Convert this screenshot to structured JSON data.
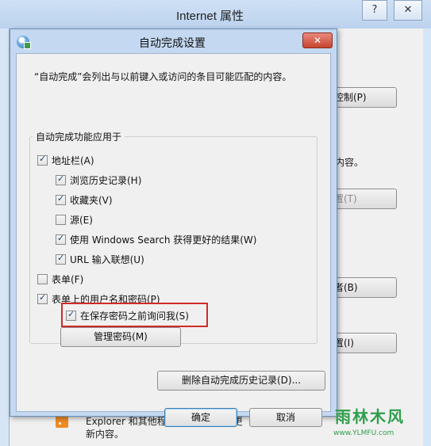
{
  "background_window": {
    "title": "Internet 属性",
    "help_label": "?",
    "close_label": "✕",
    "buttons": [
      "控制(P)",
      "置(T)",
      "者(B)",
      "置(I)"
    ],
    "fragment_text": "内容。",
    "footer_line1": "Explorer 和其他程序中读取的网站更",
    "footer_line2": "新内容。"
  },
  "dialog": {
    "title": "自动完成设置",
    "close_label": "✕",
    "description": "“自动完成”会列出与以前键入或访问的条目可能匹配的内容。",
    "group_label": "自动完成功能应用于",
    "options": {
      "address_bar": {
        "label": "地址栏(A)",
        "checked": true
      },
      "browse_history": {
        "label": "浏览历史记录(H)",
        "checked": true
      },
      "favorites": {
        "label": "收藏夹(V)",
        "checked": true
      },
      "feeds": {
        "label": "源(E)",
        "checked": false
      },
      "windows_search": {
        "label": "使用 Windows Search 获得更好的结果(W)",
        "checked": true
      },
      "url_suggest": {
        "label": "URL 输入联想(U)",
        "checked": true
      },
      "forms": {
        "label": "表单(F)",
        "checked": false
      },
      "usernames_passwords": {
        "label": "表单上的用户名和密码(P)",
        "checked": true
      },
      "ask_before_save": {
        "label": "在保存密码之前询问我(S)",
        "checked": true
      }
    },
    "manage_passwords_label": "管理密码(M)",
    "delete_history_label": "删除自动完成历史记录(D)...",
    "ok_label": "确定",
    "cancel_label": "取消"
  },
  "watermark": {
    "text": "雨林木风",
    "url": "www.YLMFU.com"
  },
  "colors": {
    "highlight_border": "#d12a2a",
    "title_close": "#c7452f",
    "window_frame": "#c4d9f1"
  }
}
